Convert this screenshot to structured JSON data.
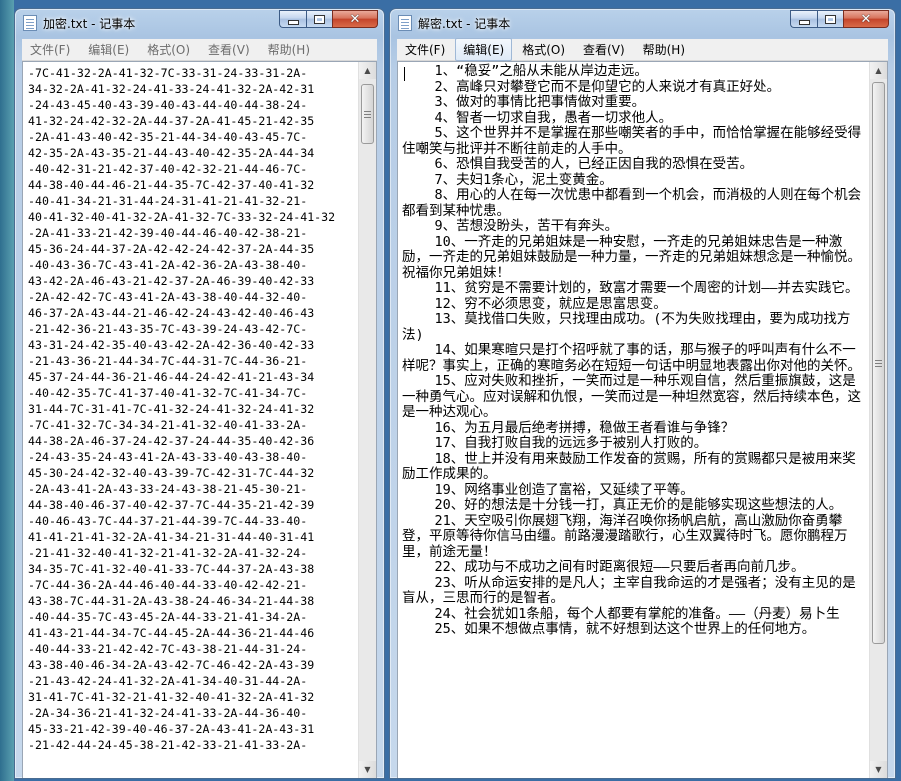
{
  "left_window": {
    "title": "加密.txt - 记事本",
    "menu": [
      "文件(F)",
      "编辑(E)",
      "格式(O)",
      "查看(V)",
      "帮助(H)"
    ],
    "lines": [
      "-7C-41-32-2A-41-32-7C-33-31-24-33-31-2A-",
      "34-32-2A-41-32-24-41-33-24-41-32-2A-42-31",
      "-24-43-45-40-43-39-40-43-44-40-44-38-24-",
      "41-32-24-42-32-2A-44-37-2A-41-45-21-42-35",
      "-2A-41-43-40-42-35-21-44-34-40-43-45-7C-",
      "42-35-2A-43-35-21-44-43-40-42-35-2A-44-34",
      "-40-42-31-21-42-37-40-42-32-21-44-46-7C-",
      "44-38-40-44-46-21-44-35-7C-42-37-40-41-32",
      "-40-41-34-21-31-44-24-31-41-21-41-32-21-",
      "40-41-32-40-41-32-2A-41-32-7C-33-32-24-41-32",
      "-2A-41-33-21-42-39-40-44-46-40-42-38-21-",
      "45-36-24-44-37-2A-42-42-24-42-37-2A-44-35",
      "-40-43-36-7C-43-41-2A-42-36-2A-43-38-40-",
      "43-42-2A-46-43-21-42-37-2A-46-39-40-42-33",
      "-2A-42-42-7C-43-41-2A-43-38-40-44-32-40-",
      "46-37-2A-43-44-21-46-42-24-43-42-40-46-43",
      "-21-42-36-21-43-35-7C-43-39-24-43-42-7C-",
      "43-31-24-42-35-40-43-42-2A-42-36-40-42-33",
      "-21-43-36-21-44-34-7C-44-31-7C-44-36-21-",
      "45-37-24-44-36-21-46-44-24-42-41-21-43-34",
      "-40-42-35-7C-41-37-40-41-32-7C-41-34-7C-",
      "31-44-7C-31-41-7C-41-32-24-41-32-24-41-32",
      "-7C-41-32-7C-34-34-21-41-32-40-41-33-2A-",
      "44-38-2A-46-37-24-42-37-24-44-35-40-42-36",
      "-24-43-35-24-43-41-2A-43-33-40-43-38-40-",
      "45-30-24-42-32-40-43-39-7C-42-31-7C-44-32",
      "-2A-43-41-2A-43-33-24-43-38-21-45-30-21-",
      "44-38-40-46-37-40-42-37-7C-44-35-21-42-39",
      "-40-46-43-7C-44-37-21-44-39-7C-44-33-40-",
      "41-41-21-41-32-2A-41-34-21-31-44-40-31-41",
      "-21-41-32-40-41-32-21-41-32-2A-41-32-24-",
      "34-35-7C-41-32-40-41-33-7C-44-37-2A-43-38",
      "-7C-44-36-2A-44-46-40-44-33-40-42-42-21-",
      "43-38-7C-44-31-2A-43-38-24-46-34-21-44-38",
      "-40-44-35-7C-43-45-2A-44-33-21-41-34-2A-",
      "41-43-21-44-34-7C-44-45-2A-44-36-21-44-46",
      "-40-44-33-21-42-42-7C-43-38-21-44-31-24-",
      "43-38-40-46-34-2A-43-42-7C-46-42-2A-43-39",
      "-21-43-42-24-41-32-2A-41-34-40-31-44-2A-",
      "31-41-7C-41-32-21-41-32-40-41-32-2A-41-32",
      "-2A-34-36-21-41-32-24-41-33-2A-44-36-40-",
      "45-33-21-42-39-40-46-37-2A-43-41-2A-43-31",
      "-21-42-44-24-45-38-21-42-33-21-41-33-2A-"
    ]
  },
  "right_window": {
    "title": "解密.txt - 记事本",
    "menu": [
      "文件(F)",
      "编辑(E)",
      "格式(O)",
      "查看(V)",
      "帮助(H)"
    ],
    "active_menu_index": 1,
    "lines": [
      "    1、“稳妥”之船从未能从岸边走远。",
      "    2、高峰只对攀登它而不是仰望它的人来说才有真正好处。",
      "    3、做对的事情比把事情做对重要。",
      "    4、智者一切求自我，愚者一切求他人。",
      "    5、这个世界并不是掌握在那些嘲笑者的手中，而恰恰掌握在能够经受得住嘲笑与批评并不断往前走的人手中。",
      "    6、恐惧自我受苦的人，已经正因自我的恐惧在受苦。",
      "    7、夫妇1条心，泥土变黄金。",
      "    8、用心的人在每一次忧患中都看到一个机会，而消极的人则在每个机会都看到某种忧患。",
      "    9、苦想没盼头，苦干有奔头。",
      "    10、一齐走的兄弟姐妹是一种安慰，一齐走的兄弟姐妹忠告是一种激励，一齐走的兄弟姐妹鼓励是一种力量，一齐走的兄弟姐妹想念是一种愉悦。祝福你兄弟姐妹！",
      "    11、贫穷是不需要计划的，致富才需要一个周密的计划——并去实践它。",
      "    12、穷不必须思变，就应是思富思变。",
      "    13、莫找借口失败，只找理由成功。(不为失败找理由，要为成功找方法)",
      "    14、如果寒暄只是打个招呼就了事的话，那与猴子的呼叫声有什么不一样呢？事实上，正确的寒暄务必在短短一句话中明显地表露出你对他的关怀。",
      "    15、应对失败和挫折，一笑而过是一种乐观自信，然后重振旗鼓，这是一种勇气心。应对误解和仇恨，一笑而过是一种坦然宽容，然后持续本色，这是一种达观心。",
      "    16、为五月最后绝考拼搏，稳做王者看谁与争锋？",
      "    17、自我打败自我的远远多于被别人打败的。",
      "    18、世上并没有用来鼓励工作发奋的赏赐，所有的赏赐都只是被用来奖励工作成果的。",
      "    19、网络事业创造了富裕，又延续了平等。",
      "    20、好的想法是十分钱一打，真正无价的是能够实现这些想法的人。",
      "    21、天空吸引你展翅飞翔，海洋召唤你扬帆启航，高山激励你奋勇攀登，平原等待你信马由缰。前路漫漫踏歌行，心生双翼待时飞。愿你鹏程万里，前途无量！",
      "    22、成功与不成功之间有时距离很短——只要后者再向前几步。",
      "    23、听从命运安排的是凡人；主宰自我命运的才是强者；没有主见的是盲从，三思而行的是智者。",
      "    24、社会犹如1条船，每个人都要有掌舵的准备。——（丹麦）易卜生",
      "    25、如果不想做点事情，就不好想到达这个世界上的任何地方。"
    ]
  },
  "icons": {
    "app": "notepad-icon",
    "minimize": "minimize-icon",
    "maximize": "maximize-icon",
    "close": "close-icon",
    "scroll_up": "scroll-up-arrow-icon",
    "scroll_down": "scroll-down-arrow-icon"
  }
}
